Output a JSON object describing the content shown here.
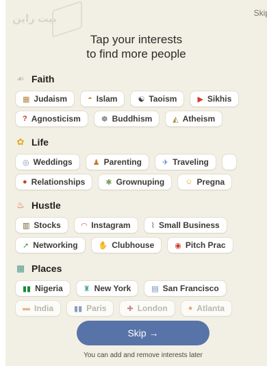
{
  "header": {
    "skip_label": "Skip",
    "watermark": "بيت راين"
  },
  "headline": [
    "Tap your interests",
    "to find more people"
  ],
  "sections": {
    "faith": {
      "icon": "praying-hands-icon",
      "title": "Faith",
      "rows": [
        [
          {
            "label": "Judaism",
            "icon": "synagogue-icon"
          },
          {
            "label": "Islam",
            "icon": "mosque-icon"
          },
          {
            "label": "Taoism",
            "icon": "taoism-icon"
          },
          {
            "label": "Sikhis",
            "icon": "sikh-flag-icon"
          }
        ],
        [
          {
            "label": "Agnosticism",
            "icon": "question-mark-icon"
          },
          {
            "label": "Buddhism",
            "icon": "buddhism-icon"
          },
          {
            "label": "Atheism",
            "icon": "atheism-icon"
          }
        ]
      ]
    },
    "life": {
      "icon": "sunflower-icon",
      "title": "Life",
      "rows": [
        [
          {
            "label": "Weddings",
            "icon": "ring-icon"
          },
          {
            "label": "Parenting",
            "icon": "family-icon"
          },
          {
            "label": "Traveling",
            "icon": "airplane-icon"
          }
        ],
        [
          {
            "label": "Relationships",
            "icon": "heart-ball-icon"
          },
          {
            "label": "Grownuping",
            "icon": "money-icon"
          },
          {
            "label": "Pregna",
            "icon": "baby-icon"
          }
        ]
      ]
    },
    "hustle": {
      "icon": "fire-icon",
      "title": "Hustle",
      "rows": [
        [
          {
            "label": "Stocks",
            "icon": "bank-icon"
          },
          {
            "label": "Instagram",
            "icon": "rainbow-icon"
          },
          {
            "label": "Small Business",
            "icon": "paperclip-icon"
          }
        ],
        [
          {
            "label": "Networking",
            "icon": "handshake-icon"
          },
          {
            "label": "Clubhouse",
            "icon": "wave-hand-icon"
          },
          {
            "label": "Pitch Prac",
            "icon": "target-icon"
          }
        ]
      ]
    },
    "places": {
      "icon": "map-icon",
      "title": "Places",
      "rows": [
        [
          {
            "label": "Nigeria",
            "icon": "nigeria-flag-icon"
          },
          {
            "label": "New York",
            "icon": "statue-of-liberty-icon"
          },
          {
            "label": "San Francisco",
            "icon": "city-icon"
          }
        ],
        [
          {
            "label": "India",
            "icon": "india-flag-icon"
          },
          {
            "label": "Paris",
            "icon": "france-flag-icon"
          },
          {
            "label": "London",
            "icon": "uk-flag-icon"
          },
          {
            "label": "Atlanta",
            "icon": "peach-icon"
          }
        ]
      ]
    }
  },
  "cta": {
    "label": "Skip →"
  },
  "footnote": "You can add and remove interests later",
  "colors": {
    "background": "#f2efe4",
    "button": "#5873a8"
  }
}
